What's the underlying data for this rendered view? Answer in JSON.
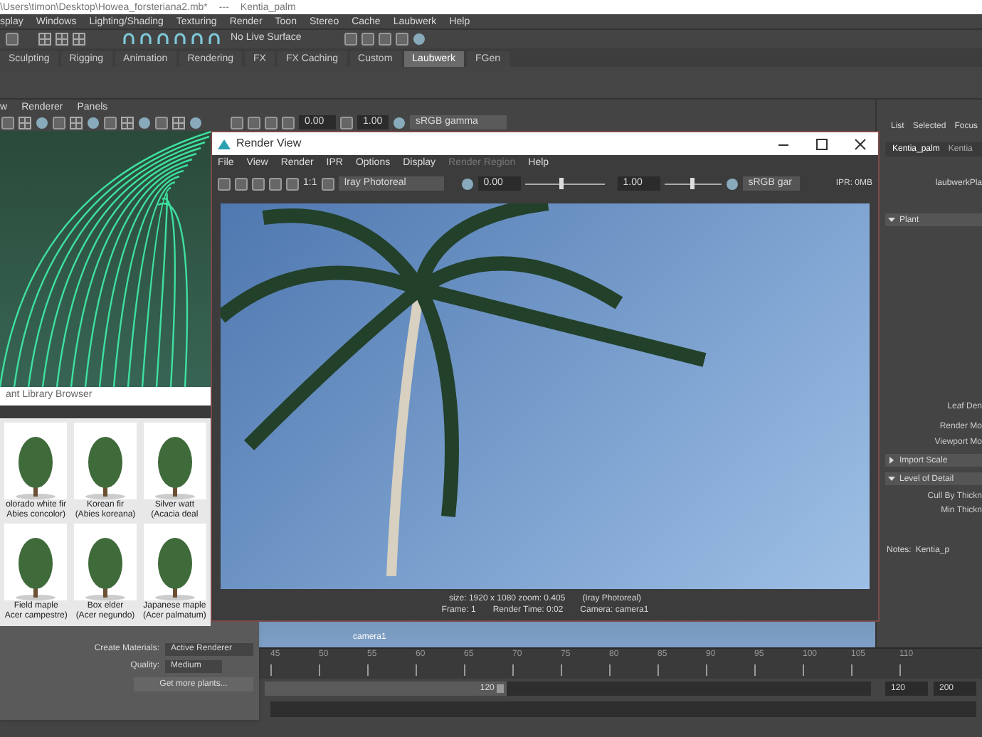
{
  "title_bar": {
    "path": "\\Users\\timon\\Desktop\\Howea_forsteriana2.mb*",
    "separator": "---",
    "scene": "Kentia_palm"
  },
  "menu_bar": [
    "splay",
    "Windows",
    "Lighting/Shading",
    "Texturing",
    "Render",
    "Toon",
    "Stereo",
    "Cache",
    "Laubwerk",
    "Help"
  ],
  "status_line": {
    "live_surface": "No Live Surface"
  },
  "shelf_tabs": [
    {
      "label": "Sculpting",
      "selected": false
    },
    {
      "label": "Rigging",
      "selected": false
    },
    {
      "label": "Animation",
      "selected": false
    },
    {
      "label": "Rendering",
      "selected": false
    },
    {
      "label": "FX",
      "selected": false
    },
    {
      "label": "FX Caching",
      "selected": false
    },
    {
      "label": "Custom",
      "selected": false
    },
    {
      "label": "Laubwerk",
      "selected": true
    },
    {
      "label": "FGen",
      "selected": false
    }
  ],
  "viewport": {
    "menu": [
      "w",
      "Renderer",
      "Panels"
    ],
    "exposure": "0.00",
    "gamma": "1.00",
    "color_space": "sRGB gamma",
    "camera_label": "camera1"
  },
  "attribute_editor": {
    "menu": [
      "List",
      "Selected",
      "Focus"
    ],
    "tabs": [
      {
        "label": "Kentia_palm",
        "selected": true
      },
      {
        "label": "Kentia",
        "selected": false
      }
    ],
    "items": [
      {
        "kind": "header",
        "text": "laubwerkPla"
      },
      {
        "kind": "section",
        "text": "Plant",
        "expanded": true
      },
      {
        "kind": "attribute",
        "text": "Leaf Den"
      },
      {
        "kind": "attribute",
        "text": "Render Mo"
      },
      {
        "kind": "attribute",
        "text": "Viewport Mo"
      },
      {
        "kind": "section",
        "text": "Import Scale",
        "expanded": false
      },
      {
        "kind": "section",
        "text": "Level of Detail",
        "expanded": true
      },
      {
        "kind": "attribute",
        "text": "Cull By Thickn"
      },
      {
        "kind": "attribute",
        "text": "Min Thickn"
      }
    ],
    "notes_label": "Notes:",
    "notes_value": "Kentia_p"
  },
  "render_view": {
    "title": "Render View",
    "menu": [
      {
        "label": "File",
        "disabled": false
      },
      {
        "label": "View",
        "disabled": false
      },
      {
        "label": "Render",
        "disabled": false
      },
      {
        "label": "IPR",
        "disabled": false
      },
      {
        "label": "Options",
        "disabled": false
      },
      {
        "label": "Display",
        "disabled": false
      },
      {
        "label": "Render Region",
        "disabled": true
      },
      {
        "label": "Help",
        "disabled": false
      }
    ],
    "zoom_ratio": "1:1",
    "renderer": "Iray Photoreal",
    "exposure": "0.00",
    "exposure_slider": {
      "level": 0.45
    },
    "gamma": "1.00",
    "gamma_slider": {
      "level": 0.5
    },
    "color_space": "sRGB gar",
    "memory": "IPR: 0MB",
    "info_line_1": [
      "size: 1920 x 1080 zoom: 0.405",
      "(Iray Photoreal)"
    ],
    "info_line_2": [
      "Frame: 1",
      "Render Time: 0:02",
      "Camera: camera1"
    ]
  },
  "plant_library": {
    "title": "ant Library Browser",
    "plants": [
      {
        "name": "olorado white fir",
        "latin": "Abies concolor)"
      },
      {
        "name": "Korean fir",
        "latin": "(Abies koreana)"
      },
      {
        "name": "Silver watt",
        "latin": "(Acacia deal"
      },
      {
        "name": "Field maple",
        "latin": "Acer campestre)"
      },
      {
        "name": "Box elder",
        "latin": "(Acer negundo)"
      },
      {
        "name": "Japanese maple",
        "latin": "(Acer palmatum)"
      }
    ],
    "materials_label": "Create Materials:",
    "materials_value": "Active Renderer",
    "quality_label": "Quality:",
    "quality_value": "Medium",
    "more_button": "Get more plants..."
  },
  "timeline": {
    "ticks": [
      "45",
      "50",
      "55",
      "60",
      "65",
      "70",
      "75",
      "80",
      "85",
      "90",
      "95",
      "100",
      "105",
      "110"
    ]
  },
  "range": {
    "level": 0.4,
    "slider_end": "120",
    "end_field": "120",
    "max_field": "200"
  }
}
